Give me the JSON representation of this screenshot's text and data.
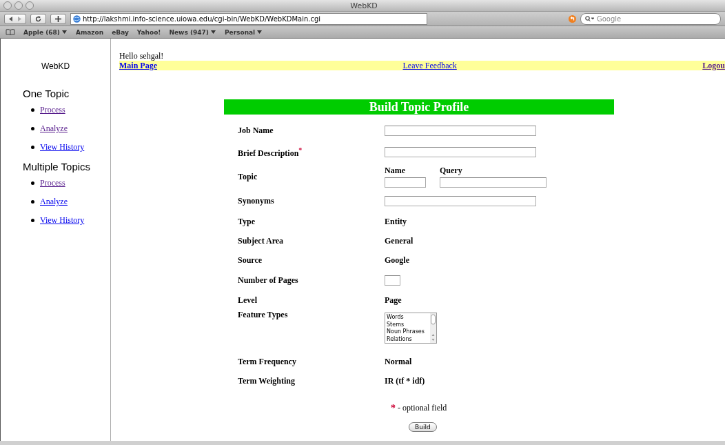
{
  "window": {
    "title": "WebKD"
  },
  "toolbar": {
    "url": "http://lakshmi.info-science.uiowa.edu/cgi-bin/WebKD/WebKDMain.cgi",
    "search_placeholder": "Google"
  },
  "bookmarks": [
    {
      "label": "Apple (68)",
      "menu": true
    },
    {
      "label": "Amazon",
      "menu": false
    },
    {
      "label": "eBay",
      "menu": false
    },
    {
      "label": "Yahoo!",
      "menu": false
    },
    {
      "label": "News (947)",
      "menu": true
    },
    {
      "label": "Personal",
      "menu": true
    }
  ],
  "sidebar": {
    "logo": "WebKD",
    "sections": [
      {
        "heading": "One Topic",
        "links": [
          {
            "label": "Process",
            "visited": true
          },
          {
            "label": "Analyze",
            "visited": true
          },
          {
            "label": "View History",
            "visited": false
          }
        ]
      },
      {
        "heading": "Multiple Topics",
        "links": [
          {
            "label": "Process",
            "visited": true
          },
          {
            "label": "Analyze",
            "visited": false
          },
          {
            "label": "View History",
            "visited": false
          }
        ]
      }
    ]
  },
  "greeting": "Hello sehgal!",
  "nav_links": [
    {
      "label": "Main Page",
      "visited": false
    },
    {
      "label": "Leave Feedback",
      "visited": false
    },
    {
      "label": "Logou",
      "visited": true
    }
  ],
  "form": {
    "title": "Build Topic Profile",
    "rows": [
      {
        "kind": "input",
        "label": "Job Name",
        "optional": false
      },
      {
        "kind": "input",
        "label": "Brief Description",
        "optional": true
      },
      {
        "kind": "topic",
        "label": "Topic",
        "optional": false,
        "fields": [
          "Name",
          "Query"
        ]
      },
      {
        "kind": "input",
        "label": "Synonyms",
        "optional": false
      },
      {
        "kind": "static",
        "label": "Type",
        "optional": false,
        "value": "Entity"
      },
      {
        "kind": "static",
        "label": "Subject Area",
        "optional": false,
        "value": "General"
      },
      {
        "kind": "static",
        "label": "Source",
        "optional": false,
        "value": "Google"
      },
      {
        "kind": "small",
        "label": "Number of Pages",
        "optional": false
      },
      {
        "kind": "static",
        "label": "Level",
        "optional": false,
        "value": "Page"
      },
      {
        "kind": "listbox",
        "label": "Feature Types",
        "optional": false,
        "options": [
          "Words",
          "Stems",
          "Noun Phrases",
          "Relations"
        ]
      },
      {
        "kind": "static",
        "label": "Term Frequency",
        "optional": false,
        "value": "Normal"
      },
      {
        "kind": "static",
        "label": "Term Weighting",
        "optional": false,
        "value": "IR (tf * idf)"
      }
    ],
    "note": {
      "mark": "*",
      "text": "- optional field"
    },
    "button": "Build"
  }
}
